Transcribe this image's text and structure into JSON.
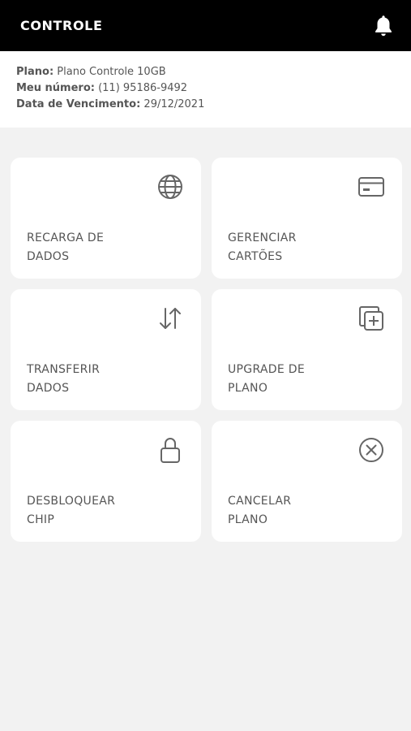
{
  "header": {
    "title": "CONTROLE",
    "notification_icon": "bell-icon"
  },
  "plan_info": {
    "plan_label": "Plano:",
    "plan_value": "Plano Controle 10GB",
    "number_label": "Meu número:",
    "number_value": "(11) 95186-9492",
    "due_label": "Data de Vencimento:",
    "due_value": "29/12/2021"
  },
  "actions": [
    {
      "line1": "RECARGA DE",
      "line2": "DADOS",
      "icon": "globe-icon"
    },
    {
      "line1": "GERENCIAR",
      "line2": "CARTÕES",
      "icon": "credit-card-icon"
    },
    {
      "line1": "TRANSFERIR",
      "line2": "DADOS",
      "icon": "transfer-arrows-icon"
    },
    {
      "line1": "UPGRADE DE",
      "line2": "PLANO",
      "icon": "add-copy-icon"
    },
    {
      "line1": "DESBLOQUEAR",
      "line2": "CHIP",
      "icon": "lock-icon"
    },
    {
      "line1": "CANCELAR",
      "line2": "PLANO",
      "icon": "close-circle-icon"
    }
  ],
  "colors": {
    "header_bg": "#000000",
    "page_bg": "#f2f2f2",
    "card_bg": "#ffffff",
    "text": "#555555",
    "icon": "#666666"
  }
}
